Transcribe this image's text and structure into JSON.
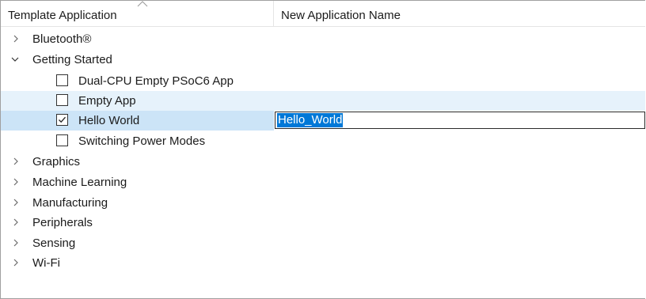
{
  "header": {
    "col1": "Template Application",
    "col2": "New Application Name"
  },
  "colors": {
    "hover_row": "#e6f2fb",
    "selected_row": "#cce4f7",
    "text_selection": "#0078d7"
  },
  "tree": {
    "bluetooth": "Bluetooth®",
    "getting_started": "Getting Started",
    "getting_started_items": [
      "Dual-CPU Empty PSoC6 App",
      "Empty App",
      "Hello World",
      "Switching Power Modes"
    ],
    "graphics": "Graphics",
    "machine_learning": "Machine Learning",
    "manufacturing": "Manufacturing",
    "peripherals": "Peripherals",
    "sensing": "Sensing",
    "wifi": "Wi-Fi"
  },
  "checked": {
    "dual_cpu": false,
    "empty_app": false,
    "hello_world": true,
    "switching_power": false
  },
  "editor": {
    "hello_world_name": "Hello_World"
  }
}
